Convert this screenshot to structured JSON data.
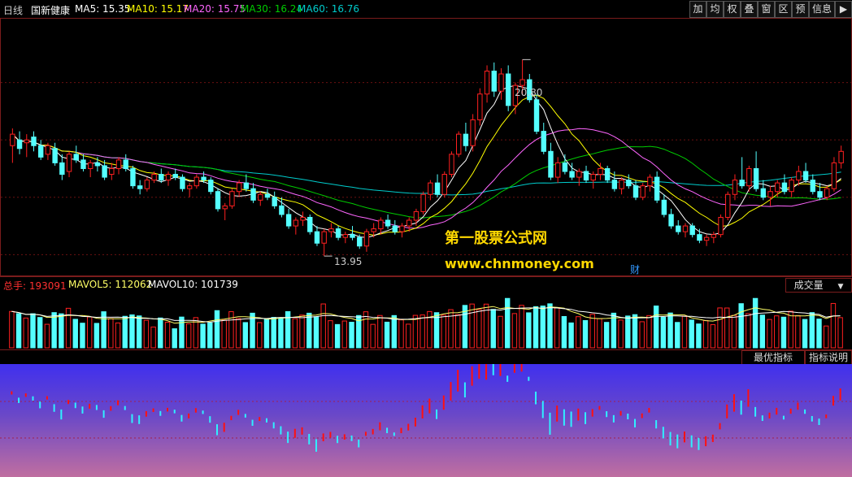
{
  "header": {
    "period": "日线",
    "stock": "国新健康",
    "ma5": "MA5: 15.35",
    "ma10": "MA10: 15.17",
    "ma20": "MA20: 15.75",
    "ma30": "MA30: 16.24",
    "ma60": "MA60: 16.76"
  },
  "toolbar": [
    "加",
    "均",
    "权",
    "叠",
    "窗",
    "区",
    "预",
    "信息",
    "▶"
  ],
  "colors": {
    "ma5": "#ffffff",
    "ma10": "#ffff00",
    "ma20": "#ff66ff",
    "ma30": "#00cc00",
    "ma60": "#00cccc",
    "up": "#ff2020",
    "down": "#54ffff"
  },
  "annotations": {
    "high": "20.80",
    "low": "13.95"
  },
  "watermark": {
    "line1": "第一股票公式网",
    "line2": "www.chnmoney.com",
    "badge": "财"
  },
  "volume": {
    "total": "总手: 193091",
    "mavol5": "MAVOL5: 112062",
    "mavol10": "MAVOL10: 101739",
    "selector": "成交量",
    "selector_arrow": "▼"
  },
  "indicator_tabs": {
    "best": "最优指标",
    "explain": "指标说明"
  },
  "chart_data": {
    "type": "candlestick",
    "price_range": [
      13.5,
      22.0
    ],
    "candles": [
      [
        17.8,
        18.4,
        17.2,
        18.2
      ],
      [
        18.0,
        18.3,
        17.5,
        17.7
      ],
      [
        17.9,
        18.2,
        17.4,
        18.0
      ],
      [
        18.1,
        18.3,
        17.6,
        17.8
      ],
      [
        17.8,
        18.0,
        17.3,
        17.4
      ],
      [
        17.5,
        17.9,
        17.3,
        17.8
      ],
      [
        17.7,
        17.9,
        17.1,
        17.2
      ],
      [
        17.2,
        17.5,
        16.6,
        16.8
      ],
      [
        16.9,
        17.6,
        16.7,
        17.5
      ],
      [
        17.5,
        17.8,
        17.2,
        17.3
      ],
      [
        17.3,
        17.5,
        16.9,
        17.0
      ],
      [
        17.0,
        17.3,
        16.7,
        17.2
      ],
      [
        17.2,
        17.4,
        16.9,
        17.1
      ],
      [
        17.1,
        17.3,
        16.6,
        16.7
      ],
      [
        16.8,
        17.2,
        16.6,
        17.0
      ],
      [
        17.0,
        17.4,
        16.8,
        17.3
      ],
      [
        17.3,
        17.5,
        16.9,
        17.0
      ],
      [
        17.0,
        17.1,
        16.3,
        16.4
      ],
      [
        16.4,
        16.6,
        16.1,
        16.3
      ],
      [
        16.3,
        16.7,
        16.2,
        16.6
      ],
      [
        16.6,
        16.9,
        16.5,
        16.8
      ],
      [
        16.8,
        17.0,
        16.5,
        16.6
      ],
      [
        16.6,
        16.9,
        16.4,
        16.8
      ],
      [
        16.8,
        17.0,
        16.6,
        16.7
      ],
      [
        16.7,
        16.8,
        16.2,
        16.3
      ],
      [
        16.3,
        16.5,
        16.0,
        16.4
      ],
      [
        16.4,
        16.8,
        16.3,
        16.7
      ],
      [
        16.7,
        16.9,
        16.5,
        16.6
      ],
      [
        16.6,
        16.7,
        16.1,
        16.2
      ],
      [
        16.2,
        16.3,
        15.5,
        15.6
      ],
      [
        15.6,
        15.8,
        15.2,
        15.7
      ],
      [
        15.7,
        16.3,
        15.6,
        16.2
      ],
      [
        16.2,
        16.6,
        16.0,
        16.5
      ],
      [
        16.5,
        16.8,
        16.2,
        16.3
      ],
      [
        16.3,
        16.5,
        15.8,
        15.9
      ],
      [
        15.9,
        16.2,
        15.7,
        16.1
      ],
      [
        16.1,
        16.3,
        15.9,
        16.0
      ],
      [
        16.0,
        16.2,
        15.6,
        15.7
      ],
      [
        15.7,
        16.0,
        15.3,
        15.4
      ],
      [
        15.4,
        15.6,
        14.9,
        15.0
      ],
      [
        15.0,
        15.3,
        14.7,
        15.2
      ],
      [
        15.2,
        15.5,
        15.0,
        15.3
      ],
      [
        15.3,
        15.4,
        14.7,
        14.8
      ],
      [
        14.8,
        15.0,
        14.3,
        14.4
      ],
      [
        14.4,
        14.9,
        13.95,
        14.8
      ],
      [
        14.8,
        15.1,
        14.6,
        14.9
      ],
      [
        14.9,
        15.0,
        14.5,
        14.6
      ],
      [
        14.6,
        14.8,
        14.4,
        14.7
      ],
      [
        14.7,
        15.0,
        14.5,
        14.6
      ],
      [
        14.6,
        14.7,
        14.2,
        14.3
      ],
      [
        14.3,
        14.9,
        14.1,
        14.8
      ],
      [
        14.8,
        15.1,
        14.6,
        14.9
      ],
      [
        14.9,
        15.3,
        14.7,
        15.2
      ],
      [
        15.2,
        15.4,
        14.9,
        15.0
      ],
      [
        15.0,
        15.2,
        14.7,
        14.8
      ],
      [
        14.8,
        15.1,
        14.6,
        15.0
      ],
      [
        15.0,
        15.3,
        14.8,
        15.2
      ],
      [
        15.2,
        15.6,
        15.0,
        15.5
      ],
      [
        15.5,
        16.2,
        15.4,
        16.1
      ],
      [
        16.1,
        16.6,
        15.9,
        16.5
      ],
      [
        16.5,
        16.8,
        16.0,
        16.1
      ],
      [
        16.1,
        16.9,
        16.0,
        16.8
      ],
      [
        16.8,
        17.6,
        16.7,
        17.5
      ],
      [
        17.5,
        18.3,
        17.4,
        18.2
      ],
      [
        18.2,
        18.6,
        17.6,
        17.8
      ],
      [
        17.8,
        18.9,
        17.6,
        18.7
      ],
      [
        18.7,
        19.8,
        18.5,
        19.6
      ],
      [
        19.6,
        20.6,
        19.3,
        20.4
      ],
      [
        20.4,
        20.7,
        19.5,
        19.7
      ],
      [
        19.7,
        20.5,
        19.4,
        20.3
      ],
      [
        20.3,
        20.6,
        19.0,
        19.2
      ],
      [
        19.2,
        20.0,
        18.9,
        19.9
      ],
      [
        19.9,
        20.8,
        19.6,
        20.1
      ],
      [
        20.1,
        20.3,
        19.3,
        19.4
      ],
      [
        19.4,
        19.6,
        18.2,
        18.3
      ],
      [
        18.3,
        18.6,
        17.5,
        17.6
      ],
      [
        17.6,
        17.9,
        16.6,
        16.7
      ],
      [
        16.7,
        17.4,
        16.5,
        17.2
      ],
      [
        17.2,
        17.5,
        16.8,
        16.9
      ],
      [
        16.9,
        17.2,
        16.6,
        16.7
      ],
      [
        16.7,
        17.0,
        16.4,
        16.9
      ],
      [
        16.9,
        17.1,
        16.5,
        16.6
      ],
      [
        16.6,
        16.9,
        16.3,
        16.8
      ],
      [
        16.8,
        17.2,
        16.6,
        17.0
      ],
      [
        17.0,
        17.1,
        16.5,
        16.6
      ],
      [
        16.6,
        16.9,
        16.2,
        16.3
      ],
      [
        16.3,
        16.7,
        16.1,
        16.6
      ],
      [
        16.6,
        16.8,
        16.3,
        16.4
      ],
      [
        16.4,
        16.6,
        15.9,
        16.0
      ],
      [
        16.0,
        16.5,
        15.9,
        16.4
      ],
      [
        16.4,
        16.8,
        16.2,
        16.7
      ],
      [
        16.7,
        16.9,
        15.8,
        15.9
      ],
      [
        15.9,
        16.1,
        15.3,
        15.4
      ],
      [
        15.4,
        15.6,
        14.9,
        15.0
      ],
      [
        15.0,
        15.2,
        14.7,
        14.8
      ],
      [
        14.8,
        15.1,
        14.6,
        15.0
      ],
      [
        15.0,
        15.1,
        14.6,
        14.7
      ],
      [
        14.7,
        14.9,
        14.4,
        14.5
      ],
      [
        14.5,
        14.7,
        14.3,
        14.6
      ],
      [
        14.6,
        14.8,
        14.4,
        14.7
      ],
      [
        14.7,
        15.4,
        14.6,
        15.3
      ],
      [
        15.3,
        16.2,
        15.2,
        16.1
      ],
      [
        16.1,
        16.8,
        15.9,
        16.6
      ],
      [
        16.6,
        17.4,
        16.3,
        16.4
      ],
      [
        16.4,
        17.1,
        16.2,
        17.0
      ],
      [
        17.0,
        17.6,
        16.2,
        16.3
      ],
      [
        16.3,
        16.6,
        15.9,
        16.0
      ],
      [
        16.0,
        16.4,
        15.7,
        16.2
      ],
      [
        16.2,
        16.6,
        16.0,
        16.5
      ],
      [
        16.5,
        16.8,
        16.1,
        16.2
      ],
      [
        16.2,
        16.7,
        16.0,
        16.6
      ],
      [
        16.6,
        17.1,
        16.4,
        16.9
      ],
      [
        16.9,
        17.2,
        16.5,
        16.6
      ],
      [
        16.6,
        16.8,
        16.1,
        16.2
      ],
      [
        16.2,
        16.5,
        15.9,
        16.0
      ],
      [
        16.0,
        16.4,
        15.9,
        16.3
      ],
      [
        16.3,
        17.4,
        16.2,
        17.2
      ],
      [
        17.2,
        17.8,
        17.0,
        17.6
      ]
    ],
    "volume_range": [
      0,
      110000
    ]
  }
}
